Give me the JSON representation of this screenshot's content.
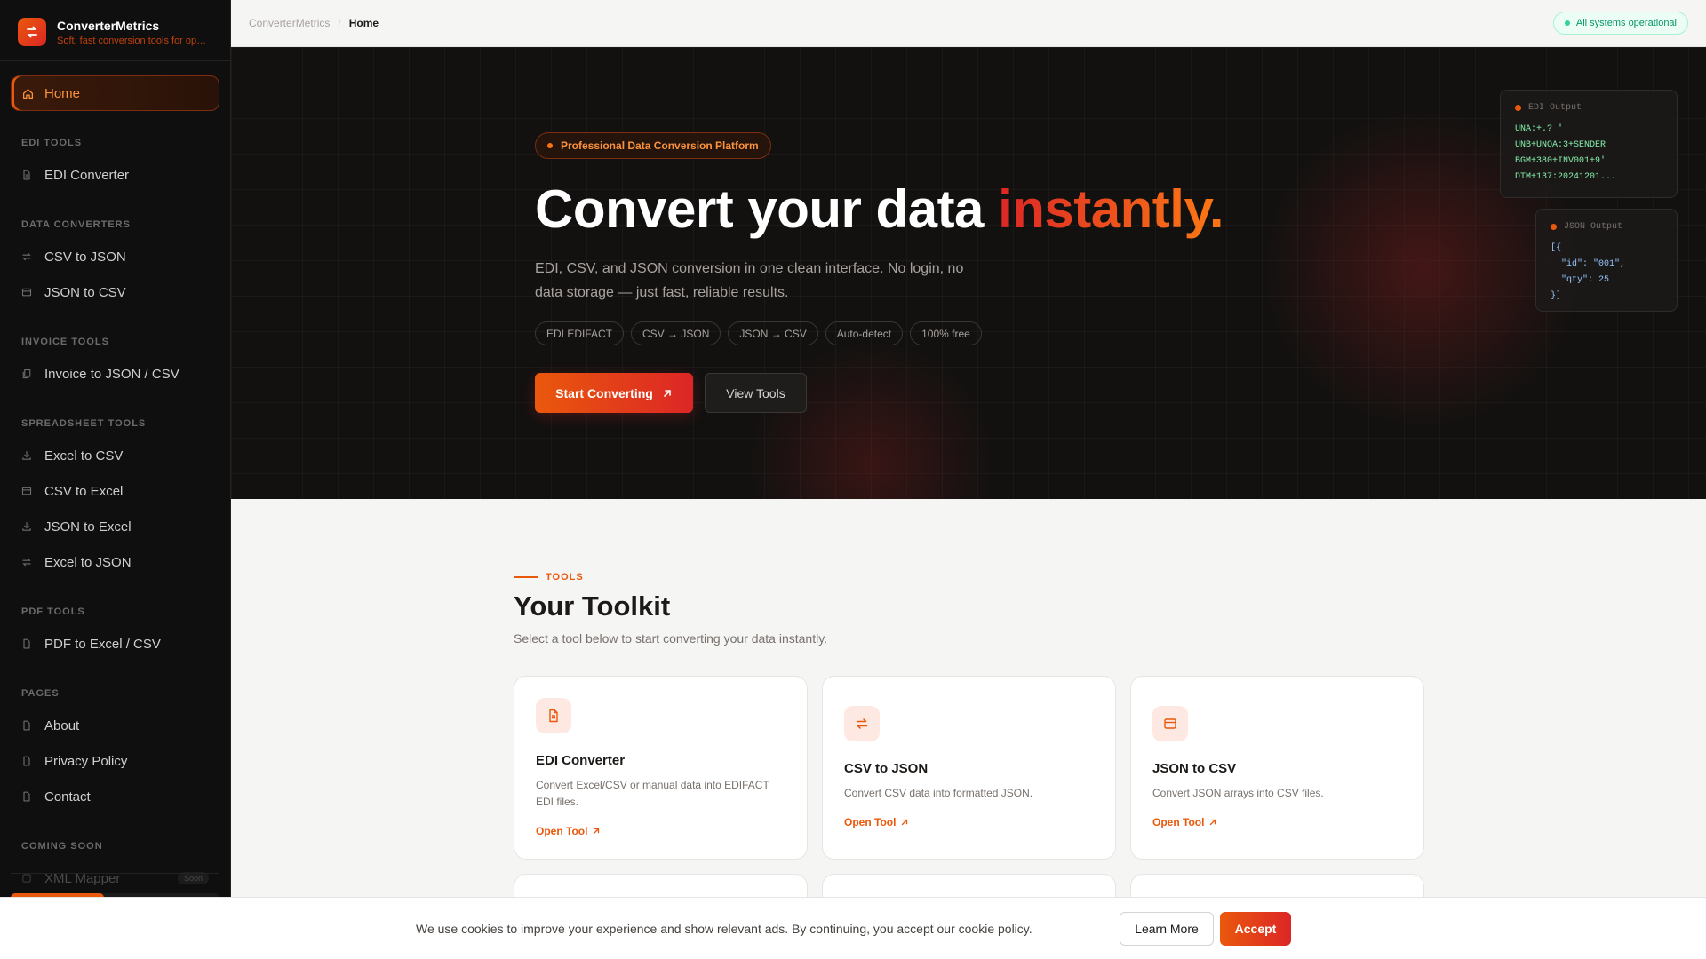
{
  "brand": {
    "name": "ConverterMetrics",
    "tagline": "Soft, fast conversion tools for operati..."
  },
  "sidebar": {
    "home": "Home",
    "sections": [
      {
        "title": "EDI TOOLS",
        "items": [
          {
            "label": "EDI Converter",
            "icon": "document-icon"
          }
        ]
      },
      {
        "title": "DATA CONVERTERS",
        "items": [
          {
            "label": "CSV to JSON",
            "icon": "swap-icon"
          },
          {
            "label": "JSON to CSV",
            "icon": "window-icon"
          }
        ]
      },
      {
        "title": "INVOICE TOOLS",
        "items": [
          {
            "label": "Invoice to JSON / CSV",
            "icon": "copy-icon"
          }
        ]
      },
      {
        "title": "SPREADSHEET TOOLS",
        "items": [
          {
            "label": "Excel to CSV",
            "icon": "download-icon"
          },
          {
            "label": "CSV to Excel",
            "icon": "window-icon"
          },
          {
            "label": "JSON to Excel",
            "icon": "download-icon"
          },
          {
            "label": "Excel to JSON",
            "icon": "swap-icon"
          }
        ]
      },
      {
        "title": "PDF TOOLS",
        "items": [
          {
            "label": "PDF to Excel / CSV",
            "icon": "file-icon"
          }
        ]
      },
      {
        "title": "PAGES",
        "items": [
          {
            "label": "About",
            "icon": "file-icon"
          },
          {
            "label": "Privacy Policy",
            "icon": "file-icon"
          },
          {
            "label": "Contact",
            "icon": "file-icon"
          }
        ]
      },
      {
        "title": "COMING SOON",
        "items": [
          {
            "label": "XML Mapper",
            "icon": "box-icon",
            "badge": "Soon"
          }
        ]
      }
    ]
  },
  "topbar": {
    "breadcrumb_root": "ConverterMetrics",
    "breadcrumb_sep": "/",
    "breadcrumb_current": "Home",
    "status": "All systems operational"
  },
  "hero": {
    "pill": "Professional Data Conversion Platform",
    "title_main": "Convert your data ",
    "title_accent": "instantly.",
    "description": "EDI, CSV, and JSON conversion in one clean interface. No login, no data storage — just fast, reliable results.",
    "chips": [
      "EDI EDIFACT",
      "CSV → JSON",
      "JSON → CSV",
      "Auto-detect",
      "100% free"
    ],
    "primary_button": "Start Converting",
    "secondary_button": "View Tools",
    "edi_card": {
      "title": "EDI Output",
      "lines": [
        "UNA:+.? '",
        "UNB+UNOA:3+SENDER",
        "BGM+380+INV001+9'",
        "DTM+137:20241201..."
      ]
    },
    "json_card": {
      "title": "JSON Output",
      "lines": [
        "[{",
        "  \"id\": \"001\",",
        "  \"qty\": 25",
        "}]"
      ]
    }
  },
  "tools": {
    "eyebrow": "TOOLS",
    "title": "Your Toolkit",
    "subtitle": "Select a tool below to start converting your data instantly.",
    "cards": [
      {
        "title": "EDI Converter",
        "desc": "Convert Excel/CSV or manual data into EDIFACT EDI files.",
        "link": "Open Tool",
        "icon": "document-icon"
      },
      {
        "title": "CSV to JSON",
        "desc": "Convert CSV data into formatted JSON.",
        "link": "Open Tool",
        "icon": "swap-icon"
      },
      {
        "title": "JSON to CSV",
        "desc": "Convert JSON arrays into CSV files.",
        "link": "Open Tool",
        "icon": "window-icon"
      }
    ]
  },
  "cookie": {
    "text": "We use cookies to improve your experience and show relevant ads. By continuing, you accept our cookie policy.",
    "learn_more": "Learn More",
    "accept": "Accept"
  },
  "colors": {
    "accent": "#ea580c",
    "accent_red": "#dc2626",
    "sidebar_bg": "#0f0f0f",
    "hero_bg": "#121110",
    "status_green": "#059669"
  }
}
